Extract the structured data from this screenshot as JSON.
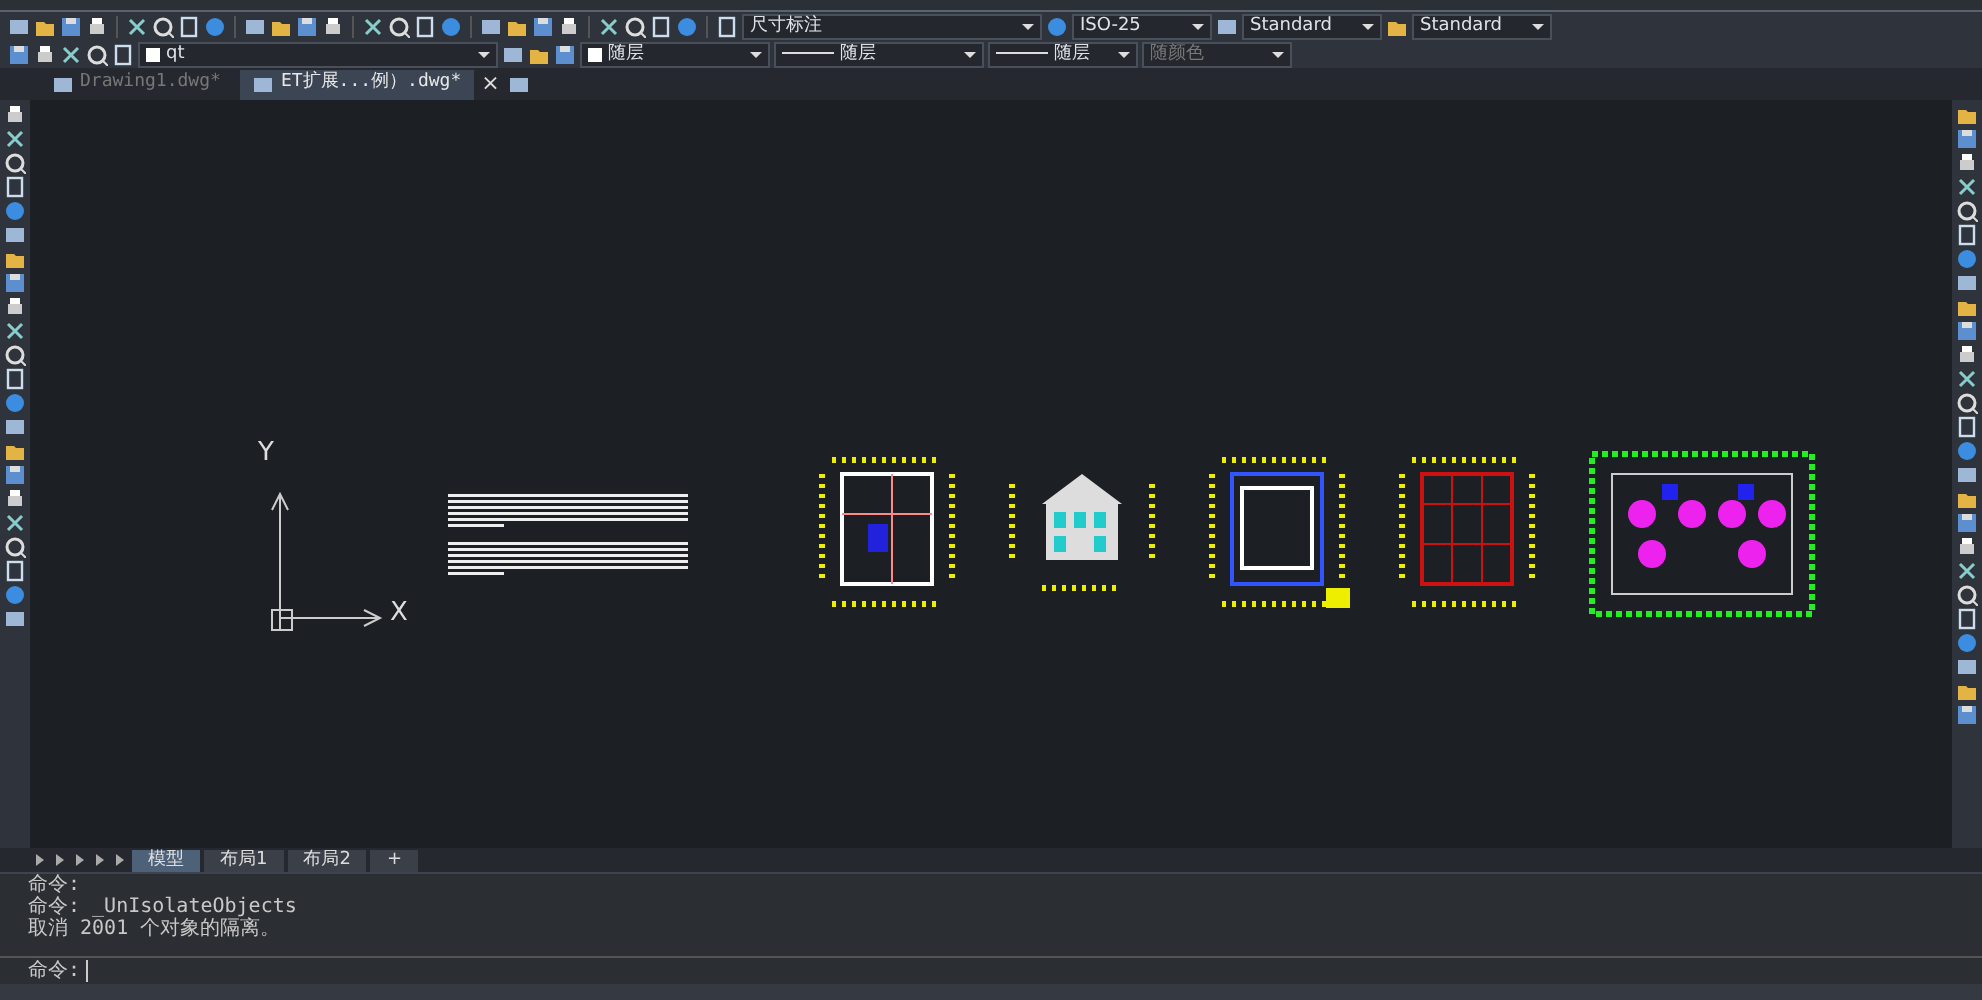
{
  "toolbar_styles": [
    {
      "kind": "text",
      "value": "尺寸标注"
    },
    {
      "kind": "dim",
      "value": "ISO-25"
    },
    {
      "kind": "table",
      "value": "Standard"
    },
    {
      "kind": "mleader",
      "value": "Standard"
    }
  ],
  "layer_toolbar": {
    "layer": "qt",
    "properties": [
      {
        "kind": "color",
        "value": "随层",
        "disabled": false
      },
      {
        "kind": "linetype",
        "value": "随层",
        "disabled": false
      },
      {
        "kind": "lineweight",
        "value": "随层",
        "disabled": false
      },
      {
        "kind": "plotstyle",
        "value": "随颜色",
        "disabled": true
      }
    ]
  },
  "document_tabs": [
    {
      "label": "Drawing1.dwg*",
      "selected": false
    },
    {
      "label": "ET扩展...例）.dwg*",
      "selected": true,
      "close": "×"
    }
  ],
  "viewport": {
    "ucs_y": "Y",
    "ucs_x": "X"
  },
  "layout_tabs": [
    {
      "label": "模型",
      "selected": true
    },
    {
      "label": "布局1",
      "selected": false
    },
    {
      "label": "布局2",
      "selected": false
    },
    {
      "label": "+",
      "selected": false
    }
  ],
  "command_history": [
    "命令:",
    "命令: _UnIsolateObjects",
    "取消 2001 个对象的隔离。"
  ],
  "command_prompt": "命令:"
}
